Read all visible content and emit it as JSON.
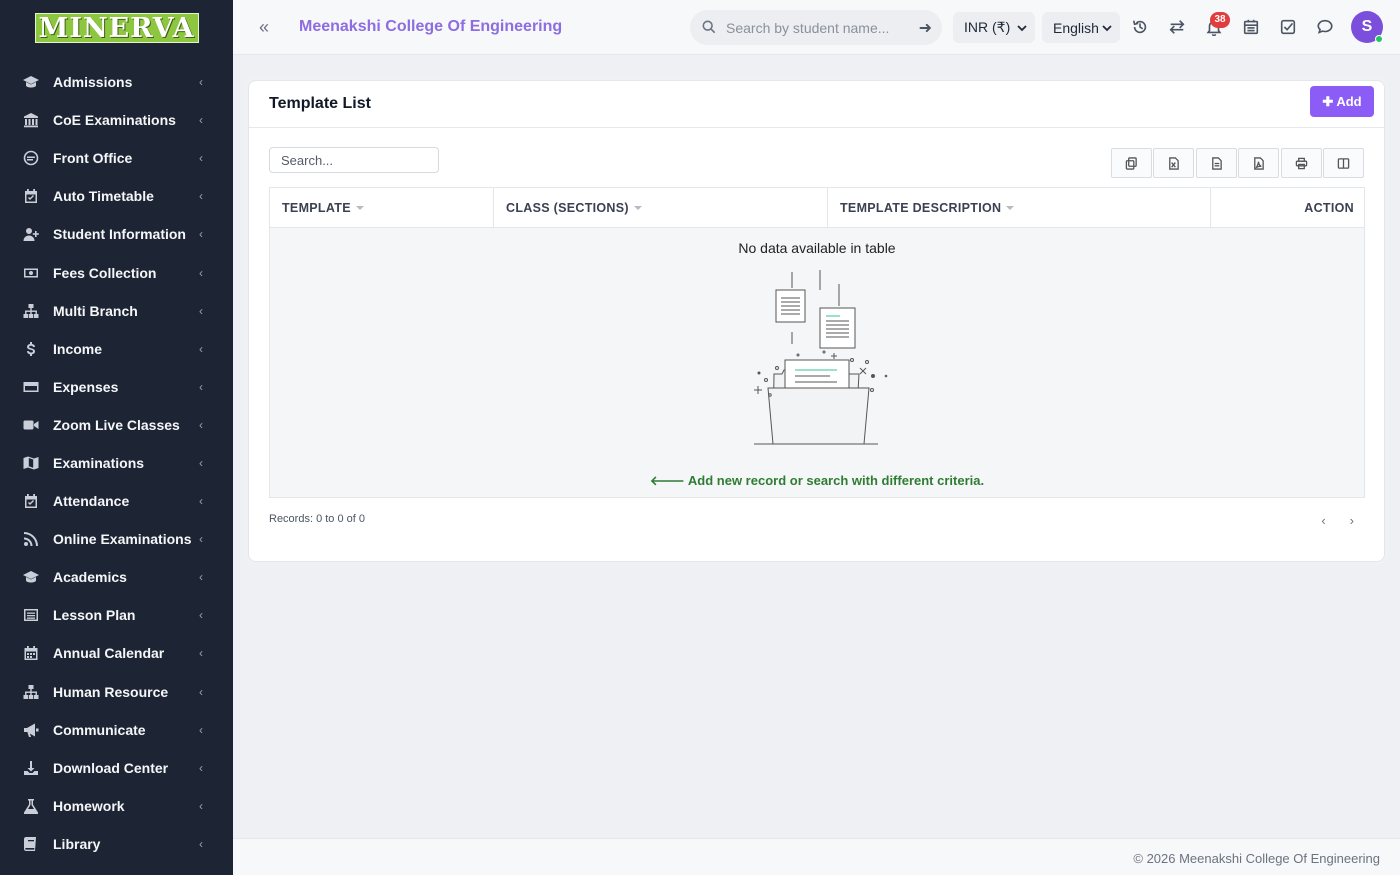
{
  "sidebar": {
    "logo": "MINERVA",
    "items": [
      {
        "label": "Admissions",
        "icon": "graduation-cap-icon"
      },
      {
        "label": "CoE Examinations",
        "icon": "bank-icon"
      },
      {
        "label": "Front Office",
        "icon": "front-office-icon"
      },
      {
        "label": "Auto Timetable",
        "icon": "calendar-check-icon"
      },
      {
        "label": "Student Information",
        "icon": "user-plus-icon"
      },
      {
        "label": "Fees Collection",
        "icon": "money-icon"
      },
      {
        "label": "Multi Branch",
        "icon": "sitemap-icon"
      },
      {
        "label": "Income",
        "icon": "dollar-icon"
      },
      {
        "label": "Expenses",
        "icon": "credit-card-icon"
      },
      {
        "label": "Zoom Live Classes",
        "icon": "video-icon"
      },
      {
        "label": "Examinations",
        "icon": "map-icon"
      },
      {
        "label": "Attendance",
        "icon": "calendar-check-icon"
      },
      {
        "label": "Online Examinations",
        "icon": "rss-icon"
      },
      {
        "label": "Academics",
        "icon": "graduation-cap-icon"
      },
      {
        "label": "Lesson Plan",
        "icon": "list-icon"
      },
      {
        "label": "Annual Calendar",
        "icon": "calendar-icon"
      },
      {
        "label": "Human Resource",
        "icon": "sitemap-icon"
      },
      {
        "label": "Communicate",
        "icon": "bullhorn-icon"
      },
      {
        "label": "Download Center",
        "icon": "download-icon"
      },
      {
        "label": "Homework",
        "icon": "flask-icon"
      },
      {
        "label": "Library",
        "icon": "book-icon"
      }
    ]
  },
  "header": {
    "college_name": "Meenakshi College Of Engineering",
    "search_placeholder": "Search by student name...",
    "currency": "INR (₹)",
    "language": "English",
    "notification_count": "38",
    "avatar_initial": "S"
  },
  "card": {
    "title": "Template List",
    "add_label": "Add",
    "search_placeholder": "Search...",
    "columns": [
      "TEMPLATE",
      "CLASS (SECTIONS)",
      "TEMPLATE DESCRIPTION",
      "ACTION"
    ],
    "empty_text": "No data available in table",
    "empty_hint": "Add new record or search with different criteria.",
    "records": "Records: 0 to 0 of 0"
  },
  "footer": {
    "copyright": "© 2026 Meenakshi College Of Engineering"
  }
}
